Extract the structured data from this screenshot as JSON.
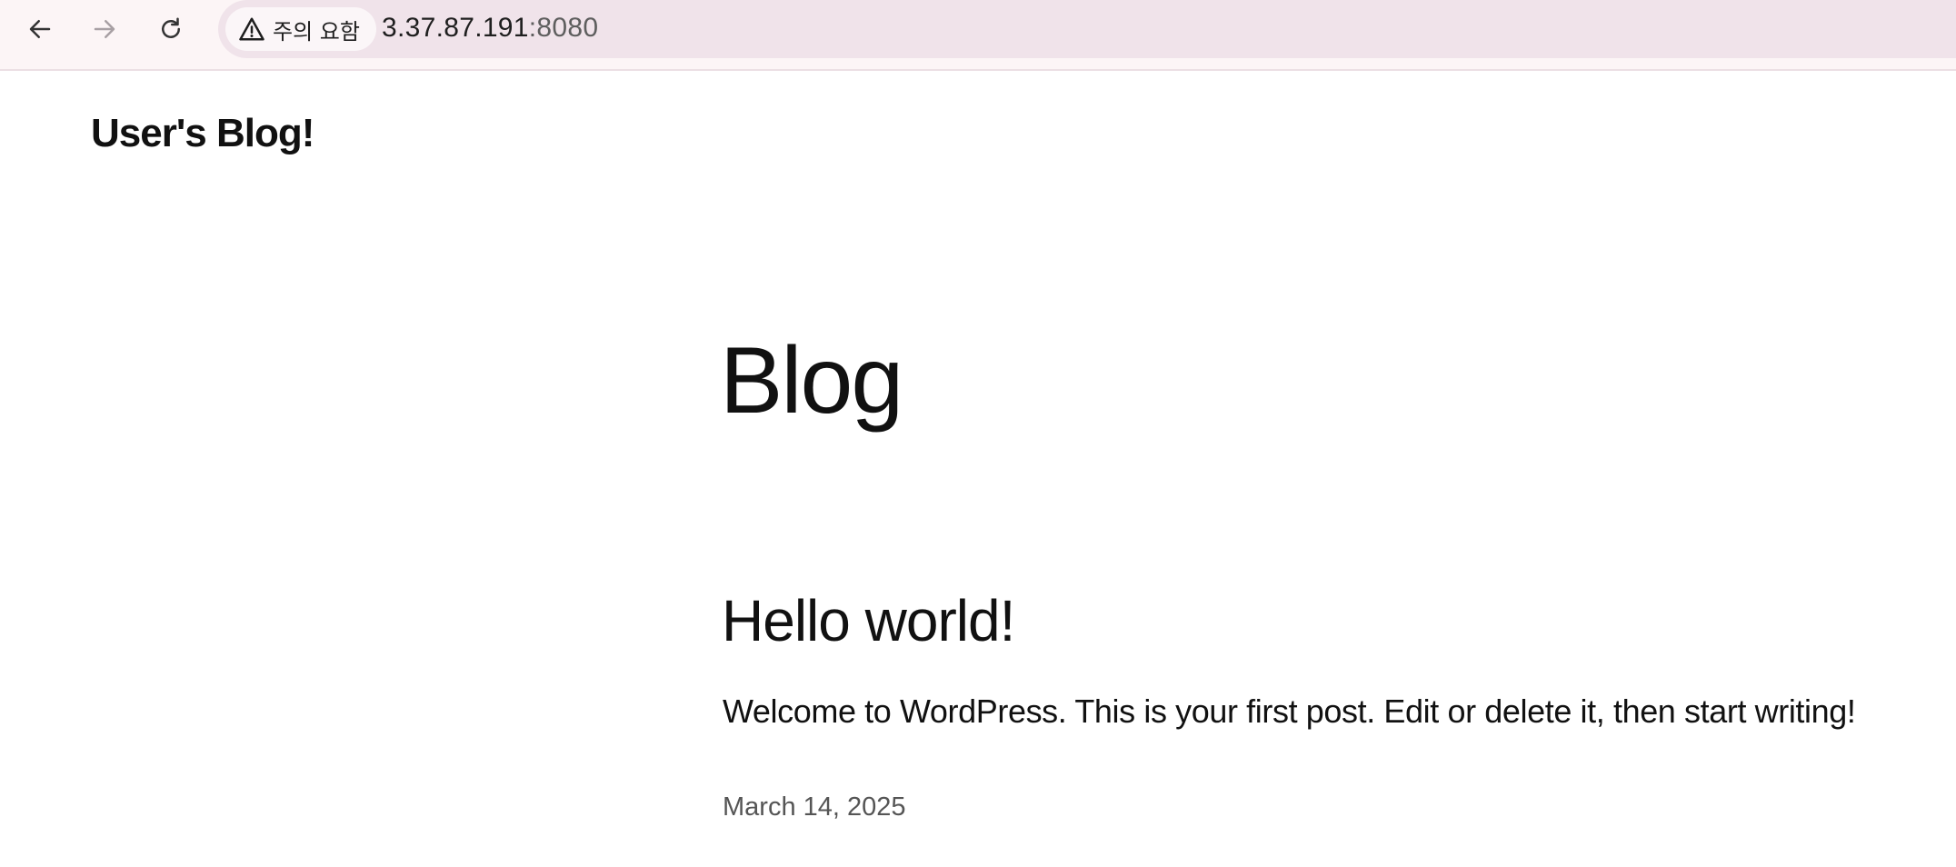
{
  "browser": {
    "security_label": "주의 요함",
    "url_host": "3.37.87.191",
    "url_port": ":8080",
    "icons": {
      "back": "arrow-left-icon",
      "forward": "arrow-right-icon",
      "reload": "reload-icon",
      "security": "warning-triangle-icon"
    }
  },
  "site": {
    "title": "User's Blog!"
  },
  "main": {
    "heading": "Blog",
    "posts": [
      {
        "title": "Hello world!",
        "excerpt": "Welcome to WordPress. This is your first post. Edit or delete it, then start writing!",
        "date": "March 14, 2025"
      }
    ]
  },
  "colors": {
    "toolbar_bg": "#fcf5f6",
    "omnibox_bg": "#f0e3ea",
    "text": "#111111",
    "date_text": "#555555"
  }
}
